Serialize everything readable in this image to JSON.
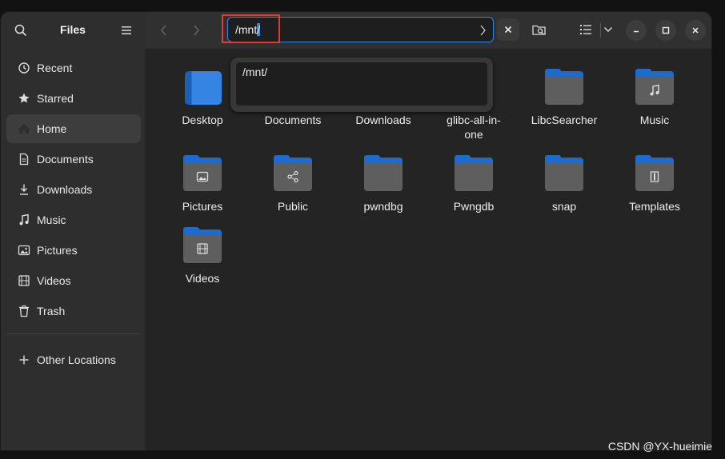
{
  "sidebar": {
    "title": "Files",
    "items": [
      {
        "label": "Recent",
        "icon": "clock-icon"
      },
      {
        "label": "Starred",
        "icon": "star-icon"
      },
      {
        "label": "Home",
        "icon": "home-icon"
      },
      {
        "label": "Documents",
        "icon": "document-icon"
      },
      {
        "label": "Downloads",
        "icon": "download-icon"
      },
      {
        "label": "Music",
        "icon": "music-icon"
      },
      {
        "label": "Pictures",
        "icon": "picture-icon"
      },
      {
        "label": "Videos",
        "icon": "video-icon"
      },
      {
        "label": "Trash",
        "icon": "trash-icon"
      }
    ],
    "other_locations": "Other Locations"
  },
  "header": {
    "path_value": "/mnt/",
    "path_unselected": "/mnt",
    "path_selected": "/"
  },
  "dropdown": {
    "suggestion": "/mnt/"
  },
  "files": [
    {
      "name": "Desktop",
      "emblem": "desktop"
    },
    {
      "name": "Documents",
      "emblem": "none"
    },
    {
      "name": "Downloads",
      "emblem": "none"
    },
    {
      "name": "glibc-all-in-one",
      "emblem": "none"
    },
    {
      "name": "LibcSearcher",
      "emblem": "none"
    },
    {
      "name": "Music",
      "emblem": "music"
    },
    {
      "name": "Pictures",
      "emblem": "picture"
    },
    {
      "name": "Public",
      "emblem": "share"
    },
    {
      "name": "pwndbg",
      "emblem": "none"
    },
    {
      "name": "Pwngdb",
      "emblem": "none"
    },
    {
      "name": "snap",
      "emblem": "none"
    },
    {
      "name": "Templates",
      "emblem": "template"
    },
    {
      "name": "Videos",
      "emblem": "video"
    }
  ],
  "watermark": "CSDN @YX-hueimie",
  "colors": {
    "accent": "#3584e4",
    "folder_tab": "#1c6bd0",
    "folder_body": "#5e5e5e",
    "highlight_box": "#e53935"
  }
}
